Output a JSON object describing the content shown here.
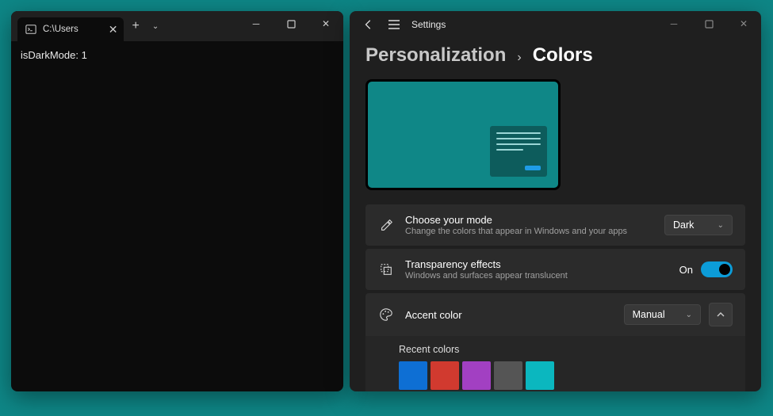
{
  "terminal": {
    "tab_title": "C:\\Users",
    "output_line": "isDarkMode: 1"
  },
  "settings": {
    "app_name": "Settings",
    "breadcrumb_parent": "Personalization",
    "breadcrumb_current": "Colors",
    "mode": {
      "title": "Choose your mode",
      "desc": "Change the colors that appear in Windows and your apps",
      "value": "Dark"
    },
    "transparency": {
      "title": "Transparency effects",
      "desc": "Windows and surfaces appear translucent",
      "state_label": "On"
    },
    "accent": {
      "title": "Accent color",
      "value": "Manual",
      "recent_label": "Recent colors",
      "colors": [
        "#0e6fd4",
        "#d13a2f",
        "#a240c2",
        "#555555",
        "#0bb7bf"
      ]
    }
  }
}
